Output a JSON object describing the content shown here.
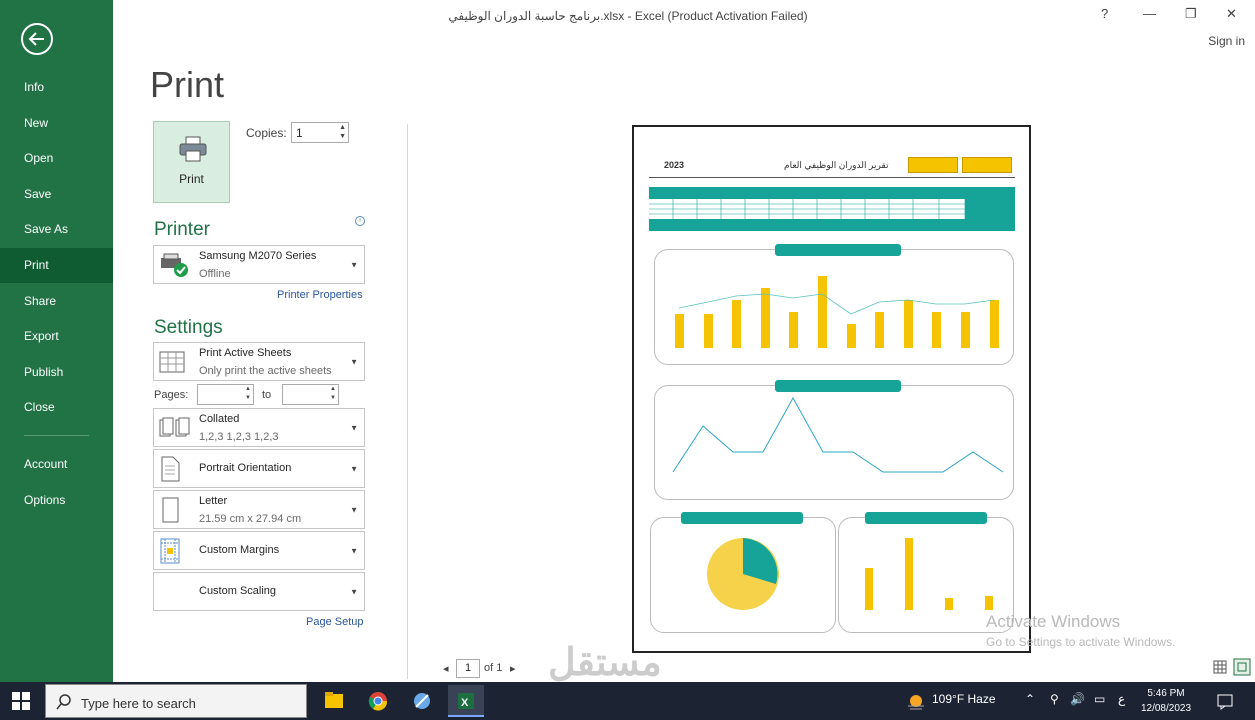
{
  "window": {
    "title": "برنامج حاسبة الدوران الوظيفي.xlsx - Excel (Product Activation Failed)",
    "help": "?",
    "minimize": "—",
    "restore": "❐",
    "close": "✕",
    "sign_in": "Sign in"
  },
  "nav": {
    "items": [
      {
        "label": "Info"
      },
      {
        "label": "New"
      },
      {
        "label": "Open"
      },
      {
        "label": "Save"
      },
      {
        "label": "Save As"
      },
      {
        "label": "Print"
      },
      {
        "label": "Share"
      },
      {
        "label": "Export"
      },
      {
        "label": "Publish"
      },
      {
        "label": "Close"
      }
    ],
    "bottom_items": [
      {
        "label": "Account"
      },
      {
        "label": "Options"
      }
    ]
  },
  "print": {
    "title": "Print",
    "print_button": "Print",
    "copies_label": "Copies:",
    "copies_value": "1",
    "printer_heading": "Printer",
    "printer_name": "Samsung M2070 Series",
    "printer_status": "Offline",
    "printer_properties": "Printer Properties",
    "settings_heading": "Settings",
    "what_to_print": "Print Active Sheets",
    "what_to_print_desc": "Only print the active sheets",
    "pages_label": "Pages:",
    "pages_to": "to",
    "collation": "Collated",
    "collation_desc": "1,2,3    1,2,3    1,2,3",
    "orientation": "Portrait Orientation",
    "paper": "Letter",
    "paper_desc": "21.59 cm x 27.94 cm",
    "margins": "Custom Margins",
    "scaling": "Custom Scaling",
    "page_setup": "Page Setup"
  },
  "preview": {
    "sheet_title": "تقرير الدوران الوظيفي العام",
    "sheet_year": "2023",
    "page_number": "1",
    "page_of": "of 1"
  },
  "overlay": {
    "activate_title": "Activate Windows",
    "activate_desc": "Go to Settings to activate Windows.",
    "watermark": "مستقل"
  },
  "taskbar": {
    "search_placeholder": "Type here to search",
    "weather": "109°F  Haze",
    "lang": "ع",
    "time": "5:46 PM",
    "date": "12/08/2023"
  },
  "colors": {
    "accent": "#217346",
    "teal": "#16a398",
    "bar": "#f6c300"
  }
}
